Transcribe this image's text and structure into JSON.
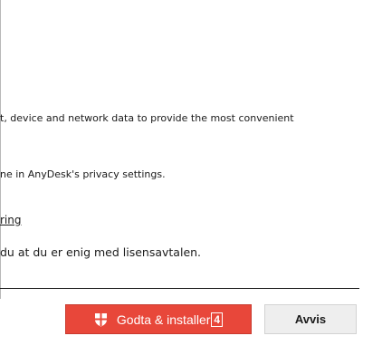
{
  "content": {
    "data_text": "t, device and network data to provide the most convenient",
    "settings_text": "ne in AnyDesk's privacy settings.",
    "link_text": "ring",
    "agree_text": "du at du er enig med lisensavtalen."
  },
  "buttons": {
    "accept_label": "Godta & installer",
    "accept_badge": "4",
    "decline_label": "Avvis"
  },
  "colors": {
    "accept_bg": "#e8473a",
    "decline_bg": "#eeeeee"
  },
  "icons": {
    "accept_icon": "anydesk-shield-icon"
  }
}
